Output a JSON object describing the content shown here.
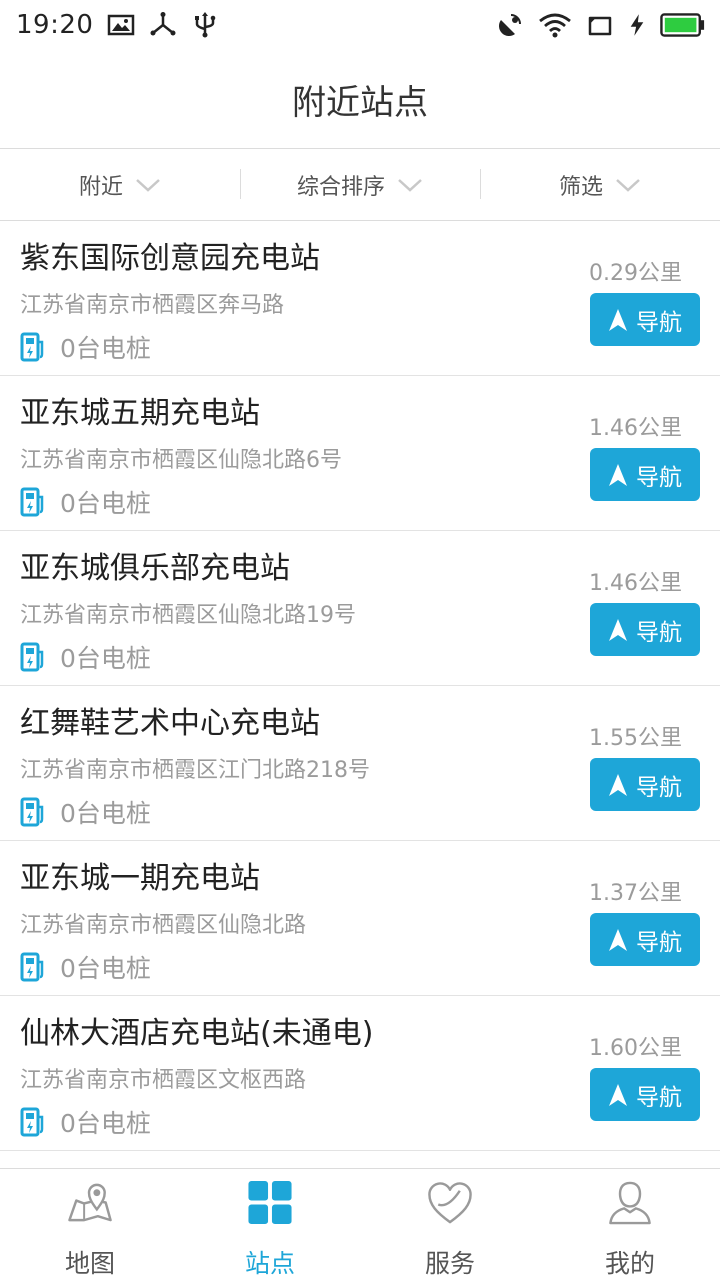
{
  "status_bar": {
    "time": "19:20"
  },
  "header": {
    "title": "附近站点"
  },
  "filters": [
    {
      "label": "附近"
    },
    {
      "label": "综合排序"
    },
    {
      "label": "筛选"
    }
  ],
  "stations": [
    {
      "name": "紫东国际创意园充电站",
      "address": "江苏省南京市栖霞区奔马路",
      "piles": "0台电桩",
      "distance": "0.29公里",
      "nav_label": "导航"
    },
    {
      "name": "亚东城五期充电站",
      "address": "江苏省南京市栖霞区仙隐北路6号",
      "piles": "0台电桩",
      "distance": "1.46公里",
      "nav_label": "导航"
    },
    {
      "name": "亚东城俱乐部充电站",
      "address": "江苏省南京市栖霞区仙隐北路19号",
      "piles": "0台电桩",
      "distance": "1.46公里",
      "nav_label": "导航"
    },
    {
      "name": "红舞鞋艺术中心充电站",
      "address": "江苏省南京市栖霞区江门北路218号",
      "piles": "0台电桩",
      "distance": "1.55公里",
      "nav_label": "导航"
    },
    {
      "name": "亚东城一期充电站",
      "address": "江苏省南京市栖霞区仙隐北路",
      "piles": "0台电桩",
      "distance": "1.37公里",
      "nav_label": "导航"
    },
    {
      "name": "仙林大酒店充电站(未通电)",
      "address": "江苏省南京市栖霞区文枢西路",
      "piles": "0台电桩",
      "distance": "1.60公里",
      "nav_label": "导航"
    }
  ],
  "tabs": [
    {
      "label": "地图",
      "icon": "map-pin-icon",
      "active": false
    },
    {
      "label": "站点",
      "icon": "grid-icon",
      "active": true
    },
    {
      "label": "服务",
      "icon": "heart-icon",
      "active": false
    },
    {
      "label": "我的",
      "icon": "user-icon",
      "active": false
    }
  ],
  "colors": {
    "accent": "#1ea6d8",
    "text_primary": "#222222",
    "text_secondary": "#9b9b9b",
    "divider": "#dcdcdc",
    "battery": "#2ecc40"
  }
}
